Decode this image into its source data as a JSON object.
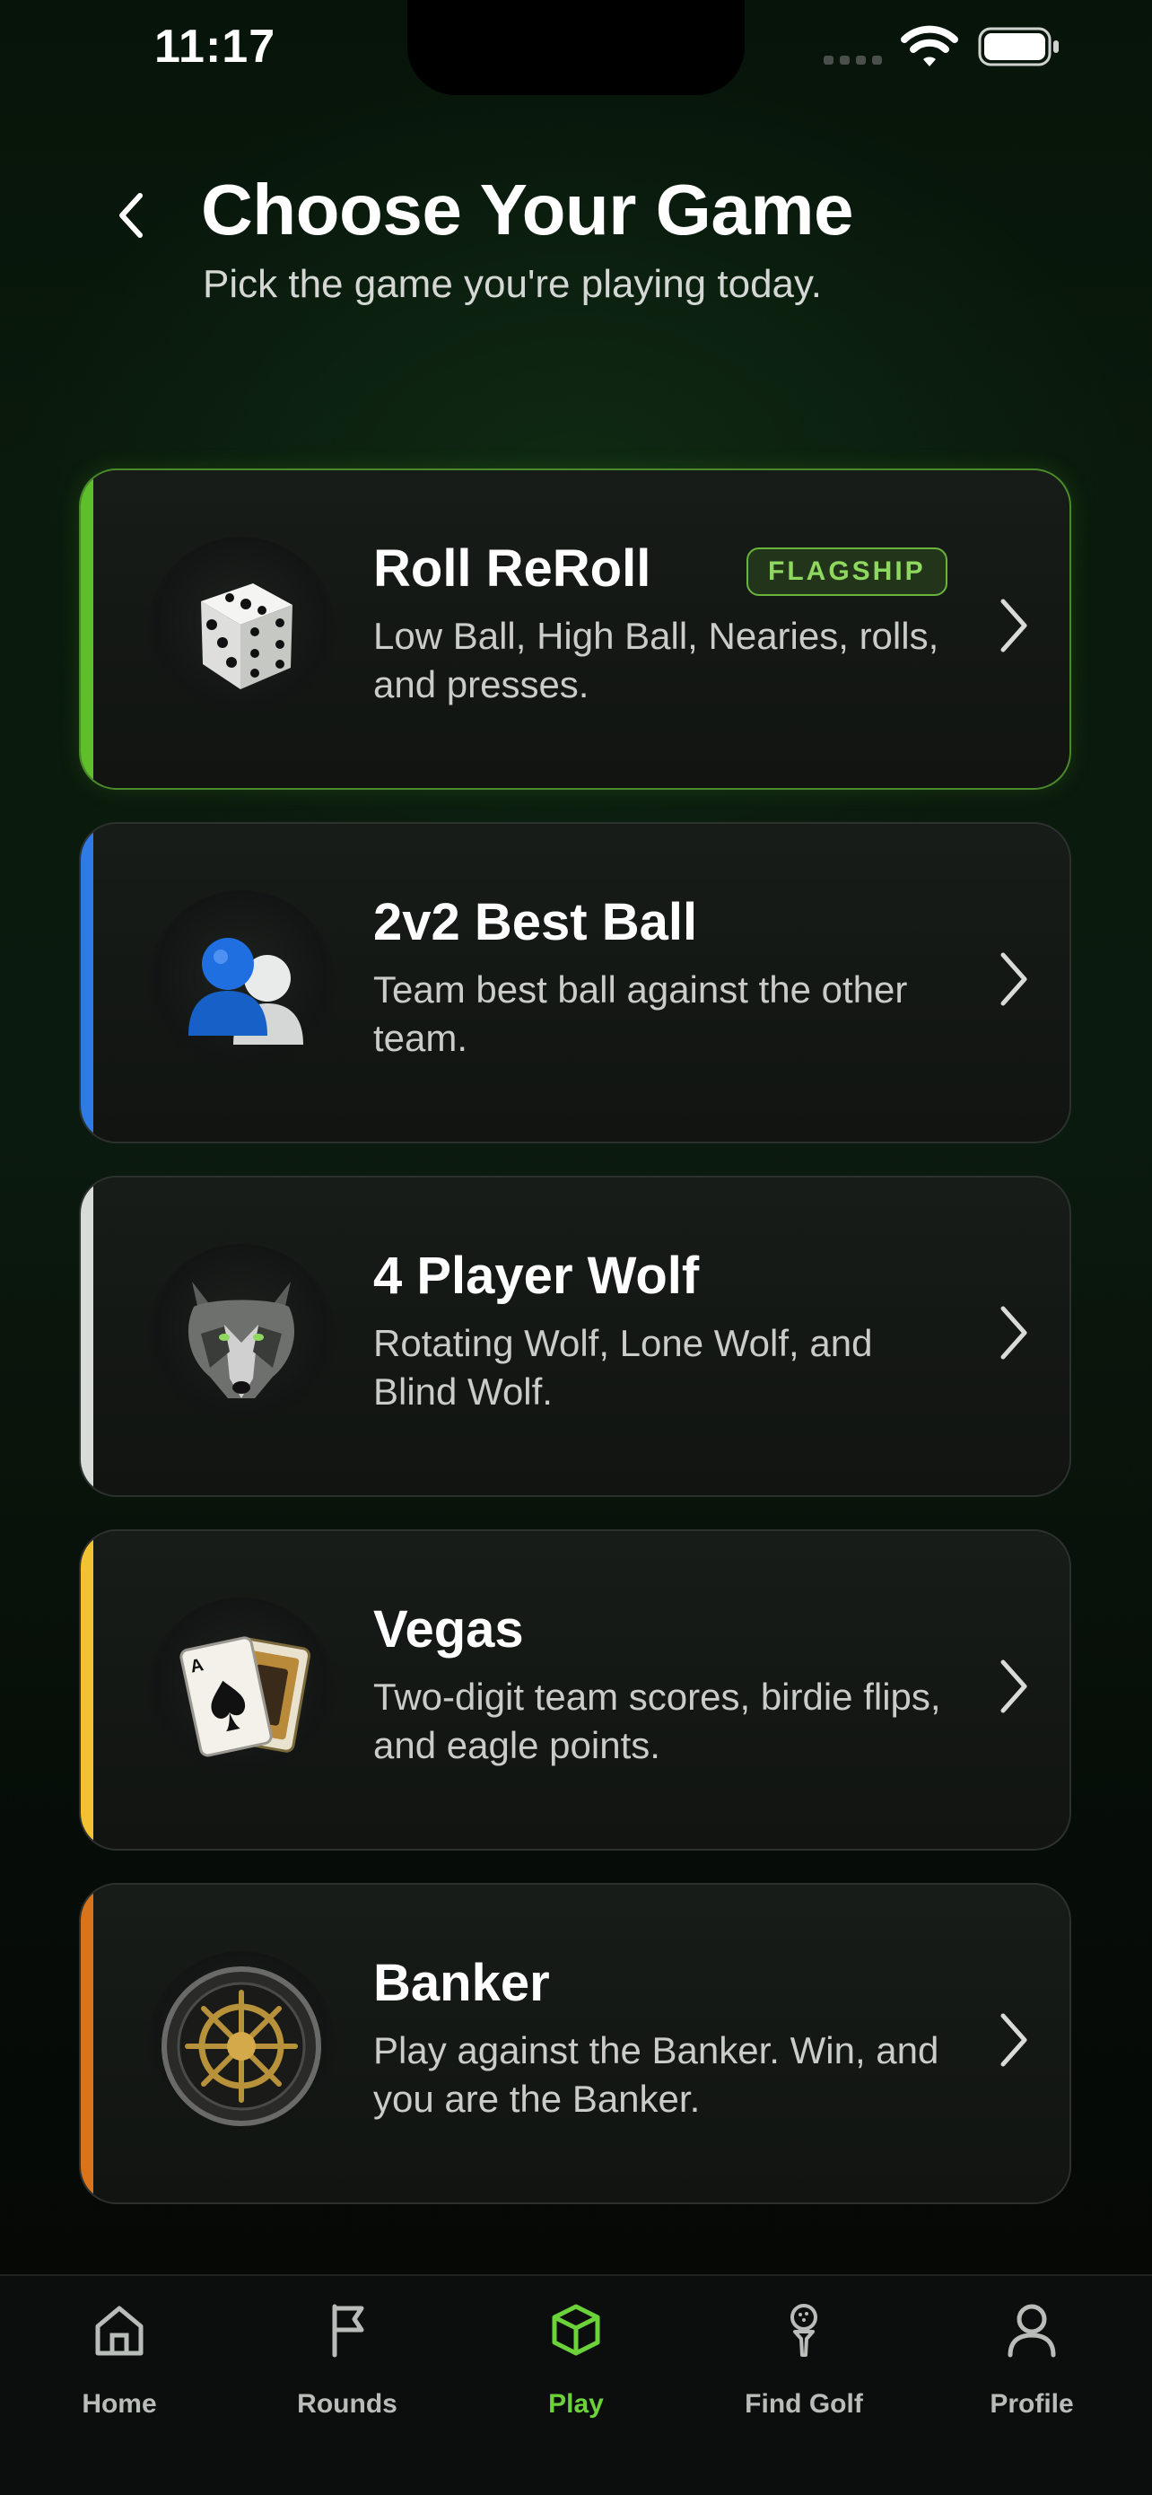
{
  "status_bar": {
    "time": "11:17"
  },
  "header": {
    "title": "Choose Your Game",
    "subtitle": "Pick the game you're playing today."
  },
  "games": [
    {
      "title": "Roll ReRoll",
      "badge": "FLAGSHIP",
      "description": "Low Ball, High Ball, Nearies, rolls, and presses.",
      "accent": "#5fbf2a",
      "icon": "dice-icon"
    },
    {
      "title": "2v2 Best Ball",
      "description": "Team best ball against the other team.",
      "accent": "#2f7be6",
      "icon": "two-players-icon"
    },
    {
      "title": "4 Player Wolf",
      "description": "Rotating Wolf, Lone Wolf, and Blind Wolf.",
      "accent": "#d8dcd8",
      "icon": "wolf-icon"
    },
    {
      "title": "Vegas",
      "description": "Two-digit team scores, birdie flips, and eagle points.",
      "accent": "#f2c230",
      "icon": "playing-cards-icon"
    },
    {
      "title": "Banker",
      "description": "Play against the Banker. Win, and you are the Banker.",
      "accent": "#d9731c",
      "icon": "vault-wheel-icon"
    }
  ],
  "tab_bar": {
    "tabs": [
      {
        "label": "Home",
        "icon": "home-icon"
      },
      {
        "label": "Rounds",
        "icon": "flag-icon"
      },
      {
        "label": "Play",
        "icon": "cube-icon",
        "active": true
      },
      {
        "label": "Find Golf",
        "icon": "golf-tee-icon"
      },
      {
        "label": "Profile",
        "icon": "person-icon"
      }
    ]
  },
  "colors": {
    "active_tab": "#6cd23a",
    "featured_border": "#4a8a2a"
  }
}
